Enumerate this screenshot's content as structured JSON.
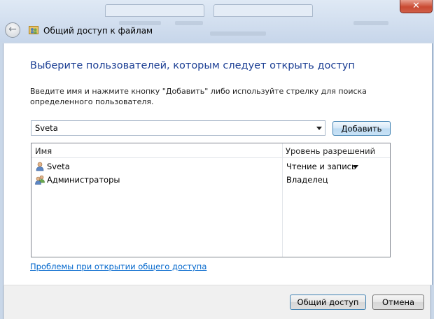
{
  "background": {
    "tab_labels": []
  },
  "window": {
    "close_glyph": "✕",
    "back_glyph": "←",
    "title": "Общий доступ к файлам"
  },
  "dialog": {
    "heading": "Выберите пользователей, которым следует открыть доступ",
    "instructions": "Введите имя и нажмите кнопку \"Добавить\" либо используйте стрелку для поиска определенного пользователя.",
    "name_input": {
      "value": "Sveta",
      "placeholder": ""
    },
    "add_button": "Добавить",
    "list": {
      "columns": {
        "name": "Имя",
        "permission": "Уровень разрешений"
      },
      "rows": [
        {
          "name": "Sveta",
          "permission": "Чтение и запись",
          "icon": "user-icon",
          "has_dropdown": true
        },
        {
          "name": "Администраторы",
          "permission": "Владелец",
          "icon": "group-icon",
          "has_dropdown": false
        }
      ]
    },
    "help_link": "Проблемы при открытии общего доступа"
  },
  "footer": {
    "share_button": "Общий доступ",
    "cancel_button": "Отмена"
  },
  "colors": {
    "heading": "#1c3f94",
    "link": "#0066cc",
    "close_button": "#c94a32"
  }
}
